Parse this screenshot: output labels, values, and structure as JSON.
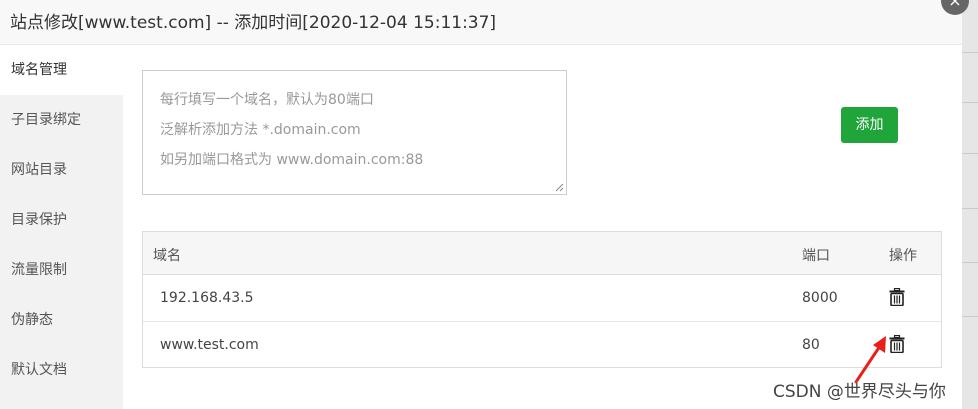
{
  "dialog": {
    "title": "站点修改[www.test.com] -- 添加时间[2020-12-04 15:11:37]",
    "close_glyph": "×"
  },
  "sidebar": {
    "items": [
      {
        "label": "域名管理",
        "active": true
      },
      {
        "label": "子目录绑定",
        "active": false
      },
      {
        "label": "网站目录",
        "active": false
      },
      {
        "label": "目录保护",
        "active": false
      },
      {
        "label": "流量限制",
        "active": false
      },
      {
        "label": "伪静态",
        "active": false
      },
      {
        "label": "默认文档",
        "active": false
      }
    ]
  },
  "domain_input": {
    "placeholder_lines": [
      "每行填写一个域名，默认为80端口",
      "泛解析添加方法 *.domain.com",
      "如另加端口格式为 www.domain.com:88"
    ],
    "value": ""
  },
  "add_button": {
    "label": "添加",
    "color": "#20a53a"
  },
  "domain_table": {
    "columns": [
      "域名",
      "端口",
      "操作"
    ],
    "rows": [
      {
        "domain": "192.168.43.5",
        "port": "8000",
        "action_icon": "trash-icon"
      },
      {
        "domain": "www.test.com",
        "port": "80",
        "action_icon": "trash-icon"
      }
    ]
  },
  "annotation": {
    "arrow_color": "#e8201a",
    "points_to": "delete-button"
  },
  "watermark": {
    "text": "CSDN @世界尽头与你"
  }
}
